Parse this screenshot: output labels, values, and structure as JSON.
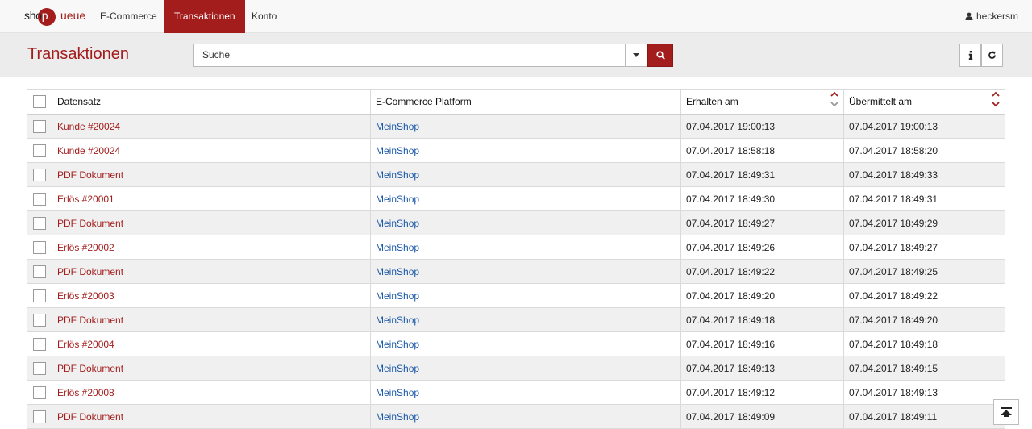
{
  "nav": {
    "brand_prefix": "sho",
    "brand_middle": "p",
    "brand_suffix": "ueue",
    "items": [
      {
        "label": "E-Commerce"
      },
      {
        "label": "Transaktionen",
        "active": true
      },
      {
        "label": "Konto"
      }
    ],
    "user": "heckersm",
    "accent_color": "#a31d1d"
  },
  "header": {
    "title": "Transaktionen",
    "search_placeholder": "Suche"
  },
  "table": {
    "columns": [
      "Datensatz",
      "E-Commerce Platform",
      "Erhalten am",
      "Übermittelt am"
    ],
    "rows": [
      {
        "datensatz": "Kunde #20024",
        "platform": "MeinShop",
        "erhalten": "07.04.2017 19:00:13",
        "uebermittelt": "07.04.2017 19:00:13"
      },
      {
        "datensatz": "Kunde #20024",
        "platform": "MeinShop",
        "erhalten": "07.04.2017 18:58:18",
        "uebermittelt": "07.04.2017 18:58:20"
      },
      {
        "datensatz": "PDF Dokument",
        "platform": "MeinShop",
        "erhalten": "07.04.2017 18:49:31",
        "uebermittelt": "07.04.2017 18:49:33"
      },
      {
        "datensatz": "Erlös #20001",
        "platform": "MeinShop",
        "erhalten": "07.04.2017 18:49:30",
        "uebermittelt": "07.04.2017 18:49:31"
      },
      {
        "datensatz": "PDF Dokument",
        "platform": "MeinShop",
        "erhalten": "07.04.2017 18:49:27",
        "uebermittelt": "07.04.2017 18:49:29"
      },
      {
        "datensatz": "Erlös #20002",
        "platform": "MeinShop",
        "erhalten": "07.04.2017 18:49:26",
        "uebermittelt": "07.04.2017 18:49:27"
      },
      {
        "datensatz": "PDF Dokument",
        "platform": "MeinShop",
        "erhalten": "07.04.2017 18:49:22",
        "uebermittelt": "07.04.2017 18:49:25"
      },
      {
        "datensatz": "Erlös #20003",
        "platform": "MeinShop",
        "erhalten": "07.04.2017 18:49:20",
        "uebermittelt": "07.04.2017 18:49:22"
      },
      {
        "datensatz": "PDF Dokument",
        "platform": "MeinShop",
        "erhalten": "07.04.2017 18:49:18",
        "uebermittelt": "07.04.2017 18:49:20"
      },
      {
        "datensatz": "Erlös #20004",
        "platform": "MeinShop",
        "erhalten": "07.04.2017 18:49:16",
        "uebermittelt": "07.04.2017 18:49:18"
      },
      {
        "datensatz": "PDF Dokument",
        "platform": "MeinShop",
        "erhalten": "07.04.2017 18:49:13",
        "uebermittelt": "07.04.2017 18:49:15"
      },
      {
        "datensatz": "Erlös #20008",
        "platform": "MeinShop",
        "erhalten": "07.04.2017 18:49:12",
        "uebermittelt": "07.04.2017 18:49:13"
      },
      {
        "datensatz": "PDF Dokument",
        "platform": "MeinShop",
        "erhalten": "07.04.2017 18:49:09",
        "uebermittelt": "07.04.2017 18:49:11"
      }
    ]
  }
}
